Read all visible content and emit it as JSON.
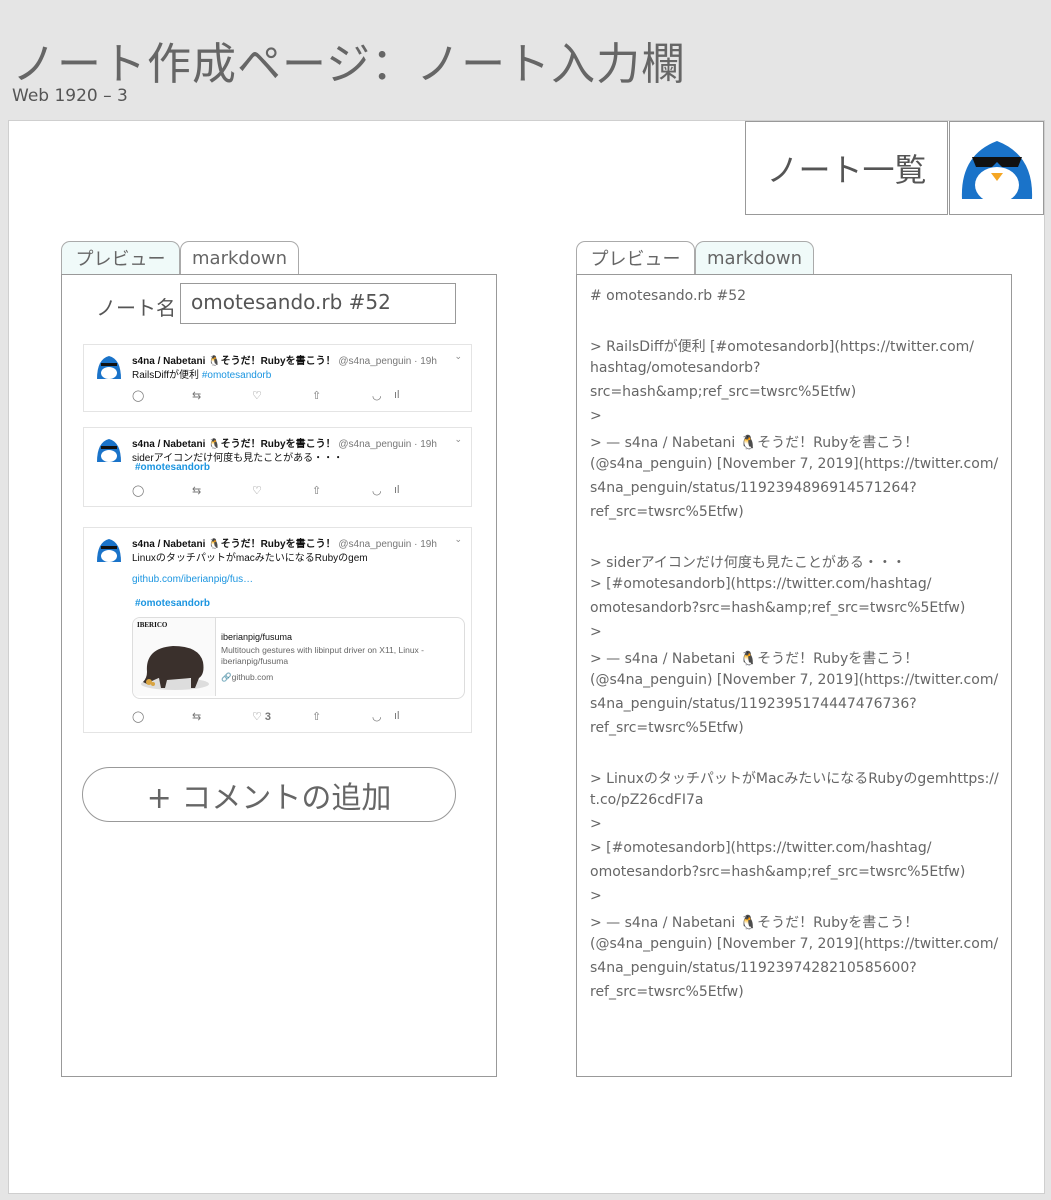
{
  "page": {
    "title": "ノート作成ページ：ノート入力欄",
    "frame_label": "Web 1920 – 3"
  },
  "header": {
    "note_list_label": "ノート一覧"
  },
  "left": {
    "tabs": [
      "プレビュー",
      "markdown"
    ],
    "note_name_label": "ノート名",
    "note_name_value": "omotesando.rb #52",
    "tweets": [
      {
        "author": "s4na / Nabetani 🐧そうだ！Rubyを書こう！",
        "handle": "@s4na_penguin · 19h",
        "text": "RailsDiffが便利 ",
        "tag": "#omotesandorb",
        "likes": ""
      },
      {
        "author": "s4na / Nabetani 🐧そうだ！Rubyを書こう！",
        "handle": "@s4na_penguin · 19h",
        "text": "siderアイコンだけ何度も見たことがある・・・",
        "tag": "#omotesandorb",
        "likes": ""
      },
      {
        "author": "s4na / Nabetani 🐧そうだ！Rubyを書こう！",
        "handle": "@s4na_penguin · 19h",
        "text": "LinuxのタッチパットがmacみたいになるRubyのgem",
        "link": "github.com/iberianpig/fus…",
        "tag": "#omotesandorb",
        "likes": "3",
        "card": {
          "image_label": "IBERICO",
          "title": "iberianpig/fusuma",
          "desc": "Multitouch gestures with libinput driver on X11, Linux - iberianpig/fusuma",
          "domain": "github.com"
        }
      }
    ],
    "add_comment_label": "+ コメントの追加"
  },
  "right": {
    "tabs": [
      "プレビュー",
      "markdown"
    ],
    "markdown_lines": [
      "# omotesando.rb #52",
      "",
      "> RailsDiffが便利 [#omotesandorb](https://twitter.com/",
      "hashtag/omotesandorb?",
      "src=hash&amp;ref_src=twsrc%5Etfw)",
      ">",
      "> — s4na / Nabetani 🐧そうだ！Rubyを書こう！",
      "(@s4na_penguin) [November 7, 2019](https://twitter.com/",
      "s4na_penguin/status/1192394896914571264?",
      "ref_src=twsrc%5Etfw)",
      "",
      "> siderアイコンだけ何度も見たことがある・・・",
      "> [#omotesandorb](https://twitter.com/hashtag/",
      "omotesandorb?src=hash&amp;ref_src=twsrc%5Etfw)",
      ">",
      "> — s4na / Nabetani 🐧そうだ！Rubyを書こう！",
      "(@s4na_penguin) [November 7, 2019](https://twitter.com/",
      "s4na_penguin/status/1192395174447476736?",
      "ref_src=twsrc%5Etfw)",
      "",
      "> LinuxのタッチパットがMacみたいになるRubyのgemhttps://",
      "t.co/pZ26cdFI7a",
      ">",
      "> [#omotesandorb](https://twitter.com/hashtag/",
      "omotesandorb?src=hash&amp;ref_src=twsrc%5Etfw)",
      ">",
      "> — s4na / Nabetani 🐧そうだ！Rubyを書こう！",
      "(@s4na_penguin) [November 7, 2019](https://twitter.com/",
      "s4na_penguin/status/1192397428210585600?",
      "ref_src=twsrc%5Etfw)"
    ]
  },
  "colors": {
    "tab_active": "#f0faf9",
    "link": "#1b95e0",
    "avatar_blue": "#1a73c9"
  },
  "icons": [
    "penguin-avatar-icon",
    "reply-icon",
    "retweet-icon",
    "like-icon",
    "share-icon",
    "save-icon",
    "analytics-icon",
    "chevron-down-icon",
    "link-icon"
  ]
}
